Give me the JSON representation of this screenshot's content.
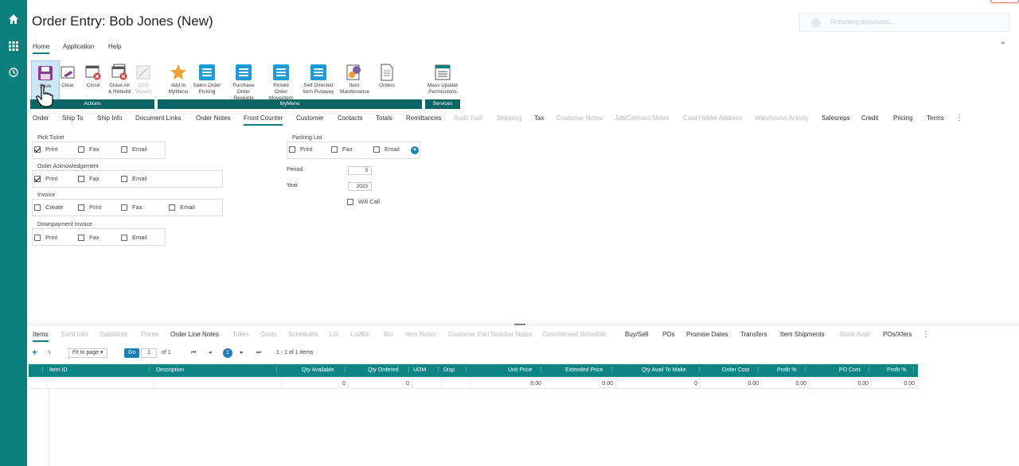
{
  "nav": {
    "icons": [
      "home-icon",
      "apps-grid-icon",
      "history-icon"
    ]
  },
  "title": "Order Entry: Bob Jones (New)",
  "status": {
    "text": "Retrieving document..."
  },
  "menubar": {
    "items": [
      "Home",
      "Application",
      "Help"
    ]
  },
  "ribbon": {
    "buttons": [
      {
        "label": "Save",
        "icon": "save-icon"
      },
      {
        "label": "Clear",
        "icon": "clear-icon"
      },
      {
        "label": "Close",
        "icon": "close-icon"
      },
      {
        "label": "Close All\n& Rebuild",
        "icon": "close-all-icon"
      },
      {
        "label": "QTO\nWizard",
        "icon": "wizard-icon"
      },
      {
        "label": "Add to\nMyMenu",
        "icon": "star-icon"
      },
      {
        "label": "Sales Order\nPicking",
        "icon": "sales-order-picking-icon"
      },
      {
        "label": "Purchase Order\nReceipts",
        "icon": "po-receipts-icon"
      },
      {
        "label": "Picked Order\nMovement",
        "icon": "picked-order-icon"
      },
      {
        "label": "Self Directed\nItem Putaway",
        "icon": "putaway-icon"
      },
      {
        "label": "Item\nMaintenance",
        "icon": "item-maintenance-icon"
      },
      {
        "label": "Orders",
        "icon": "orders-icon"
      },
      {
        "label": "Mass Update\nPermissions",
        "icon": "mass-update-icon"
      }
    ],
    "groups": [
      "Actions",
      "MyMenu",
      "Services"
    ]
  },
  "tabs": [
    "Order",
    "Ship To",
    "Ship Info",
    "Document Links",
    "Order Notes",
    "Front Counter",
    "Customer",
    "Contacts",
    "Totals",
    "Remittances",
    "Audit Trail",
    "Shipping",
    "Tax",
    "Customer Notes",
    "Job/Contract Notes",
    "Card Holder Address",
    "Warehouse Activity",
    "Salesreps",
    "Credit",
    "Pricing",
    "Terms"
  ],
  "front_counter": {
    "pick_ticket": {
      "label": "Pick Ticket",
      "print": "Print",
      "fax": "Fax",
      "email": "Email"
    },
    "order_ack": {
      "label": "Order Acknowledgement",
      "print": "Print",
      "fax": "Fax",
      "email": "Email"
    },
    "invoice": {
      "label": "Invoice",
      "create": "Create",
      "print": "Print",
      "fax": "Fax",
      "email": "Email"
    },
    "downpayment": {
      "label": "Downpayment Invoice",
      "print": "Print",
      "fax": "Fax",
      "email": "Email"
    },
    "packing_list": {
      "label": "Packing List",
      "print": "Print",
      "fax": "Fax",
      "email": "Email"
    },
    "period": {
      "label": "Period",
      "value": "3"
    },
    "year": {
      "label": "Year",
      "value": "2023"
    },
    "will_call": "Will Call"
  },
  "bottom_tabs": [
    "Items",
    "Ext'd Info",
    "Substitute",
    "Prices",
    "Order Line Notes",
    "Taxes",
    "Costs",
    "Schedules",
    "Lot",
    "Lot/Bin",
    "Bin",
    "Item Notes",
    "Customer Part Number Notes",
    "Commitment Schedule",
    "Buy/Sell",
    "POs",
    "Promise Dates",
    "Transfers",
    "Item Shipments",
    "Stock Avail",
    "POs/Xfers"
  ],
  "pager": {
    "fit": "Fit to page",
    "go": "Go",
    "page": "1",
    "of": "of 1",
    "current": "1",
    "count": "1 - 1 of 1 items"
  },
  "grid": {
    "columns": [
      "Item ID",
      "Description",
      "Qty Available",
      "Qty Ordered",
      "UOM",
      "Disp",
      "Unit Price",
      "Extended Price",
      "Qty Avail To Make",
      "Order Cost",
      "Profit %",
      "PO Cost",
      "Profit %"
    ],
    "row": [
      "",
      "",
      "0",
      "0",
      "",
      "",
      "0.00",
      "0.00",
      "0",
      "0.00",
      "0.00",
      "0.00",
      "0.00"
    ]
  }
}
